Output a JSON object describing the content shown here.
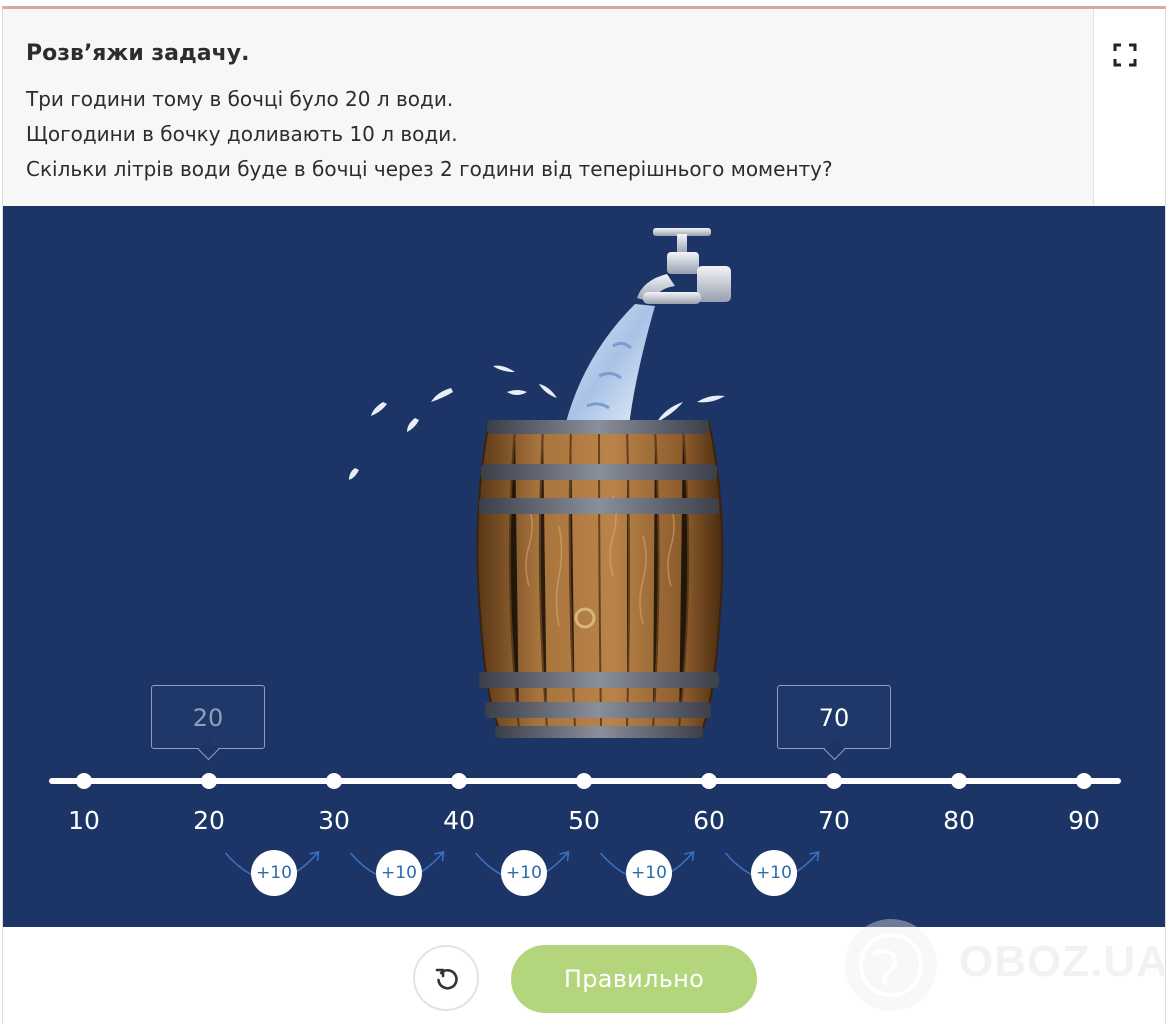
{
  "task": {
    "title": "Розв’яжи задачу.",
    "lines": [
      "Три години тому в бочці було 20 л води.",
      "Щогодини в бочку доливають 10 л води.",
      "Скільки літрів води буде в бочці через 2 години від теперішнього моменту?"
    ]
  },
  "number_line": {
    "ticks": [
      "10",
      "20",
      "30",
      "40",
      "50",
      "60",
      "70",
      "80",
      "90"
    ],
    "callouts": [
      {
        "value": "20",
        "text_color": "#8fa0b8"
      },
      {
        "value": "70",
        "text_color": "#ffffff"
      }
    ],
    "steps": [
      "+10",
      "+10",
      "+10",
      "+10",
      "+10"
    ]
  },
  "buttons": {
    "reset_icon": "reset-icon",
    "check_label": "Правильно"
  },
  "watermark": {
    "text": "OBOZ.UA"
  },
  "colors": {
    "stage_bg": "#1c3566",
    "check_button": "#b3d57c",
    "step_text": "#2b6cb0",
    "top_border": "#dba6a8"
  }
}
